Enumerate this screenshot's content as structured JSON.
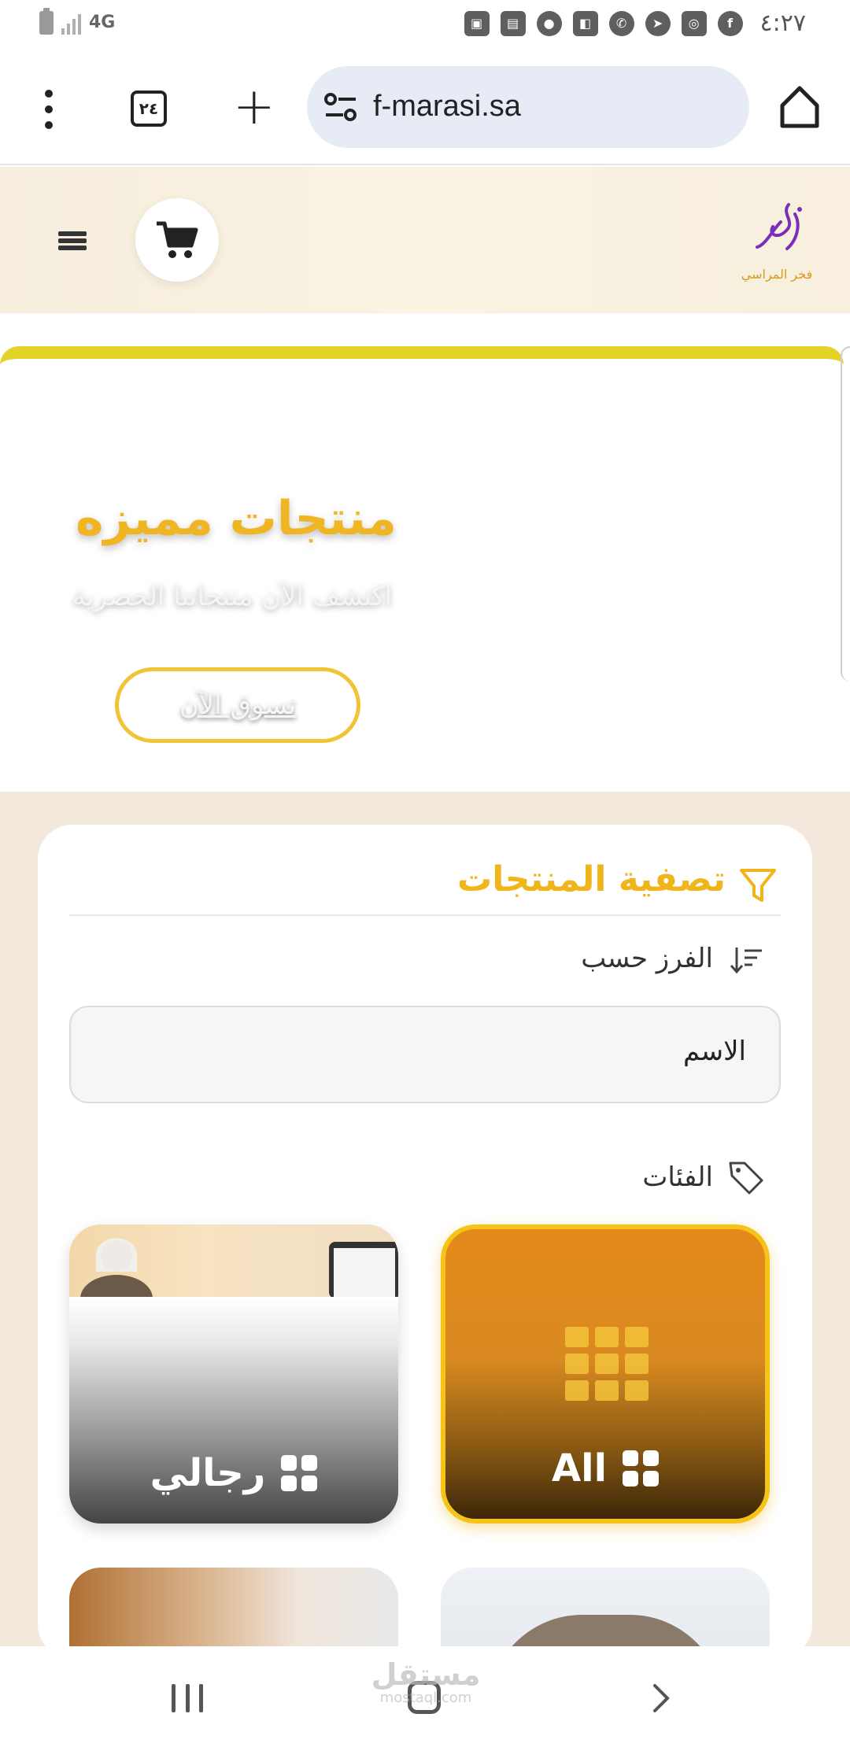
{
  "status_bar": {
    "network": "4G",
    "clock": "٤:٢٧",
    "notification_icons": [
      "gallery-icon",
      "wallet-icon",
      "account-icon",
      "contact-card-icon",
      "whatsapp-icon",
      "telegram-icon",
      "instagram-icon",
      "facebook-icon"
    ]
  },
  "browser": {
    "tab_count": "٢٤",
    "url": "f-marasi.sa"
  },
  "site": {
    "logo_text": "فخر المراسي",
    "accent_color": "#f1b51c"
  },
  "hero": {
    "title": "منتجات مميزه",
    "subtitle": "اكتشف الآن منتجاتنا الحصرية",
    "cta": "تسوق الآن"
  },
  "filter": {
    "title": "تصفية المنتجات",
    "sort_label": "الفرز حسب",
    "sort_value": "الاسم",
    "categories_label": "الفئات",
    "categories": [
      {
        "label": "All",
        "selected": true
      },
      {
        "label": "رجالي",
        "selected": false
      }
    ]
  },
  "watermark": {
    "arabic": "مستقل",
    "latin": "mostaql.com"
  }
}
